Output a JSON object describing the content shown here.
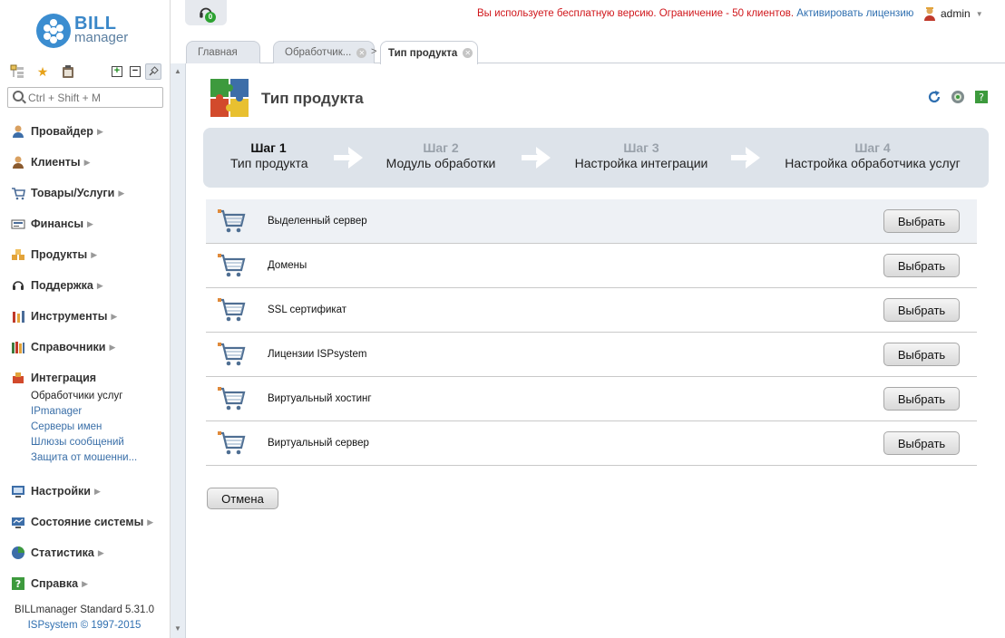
{
  "app": {
    "logo_word1": "BILL",
    "logo_word2": "manager",
    "version_line1": "BILLmanager Standard 5.31.0",
    "version_line2": "ISPsystem © 1997-2015"
  },
  "header": {
    "notification_count": "0",
    "license_notice": "Вы используете бесплатную версию. Ограничение - 50 клиентов.",
    "license_link": "Активировать лицензию",
    "user": "admin"
  },
  "search": {
    "placeholder": "Ctrl + Shift + M"
  },
  "sidebar": {
    "items": [
      {
        "label": "Провайдер",
        "icon": "provider-icon"
      },
      {
        "label": "Клиенты",
        "icon": "clients-icon"
      },
      {
        "label": "Товары/Услуги",
        "icon": "cart-icon"
      },
      {
        "label": "Финансы",
        "icon": "finance-icon"
      },
      {
        "label": "Продукты",
        "icon": "products-icon"
      },
      {
        "label": "Поддержка",
        "icon": "headset-icon"
      },
      {
        "label": "Инструменты",
        "icon": "tools-icon"
      },
      {
        "label": "Справочники",
        "icon": "reference-icon"
      },
      {
        "label": "Интеграция",
        "icon": "integration-icon"
      },
      {
        "label": "Настройки",
        "icon": "settings-icon"
      },
      {
        "label": "Состояние системы",
        "icon": "monitor-icon"
      },
      {
        "label": "Статистика",
        "icon": "stats-icon"
      },
      {
        "label": "Справка",
        "icon": "help-icon"
      }
    ],
    "integration_subitems": [
      "Обработчики услуг",
      "IPmanager",
      "Серверы имен",
      "Шлюзы сообщений",
      "Защита от мошенни..."
    ]
  },
  "tabs": [
    {
      "label": "Главная"
    },
    {
      "label": "Обработчик..."
    },
    {
      "label": "Тип продукта"
    }
  ],
  "page": {
    "title": "Тип продукта"
  },
  "wizard": {
    "steps": [
      {
        "number": "Шаг 1",
        "title": "Тип продукта"
      },
      {
        "number": "Шаг 2",
        "title": "Модуль обработки"
      },
      {
        "number": "Шаг 3",
        "title": "Настройка интеграции"
      },
      {
        "number": "Шаг 4",
        "title": "Настройка обработчика услуг"
      }
    ]
  },
  "products": {
    "select_label": "Выбрать",
    "items": [
      "Выделенный сервер",
      "Домены",
      "SSL сертификат",
      "Лицензии ISPsystem",
      "Виртуальный хостинг",
      "Виртуальный сервер"
    ]
  },
  "cancel_label": "Отмена",
  "colors": {
    "link": "#2f6fb0",
    "warning": "#d0161b",
    "wizard_bg": "#dde3ea",
    "logo": "#3b8dd0"
  }
}
